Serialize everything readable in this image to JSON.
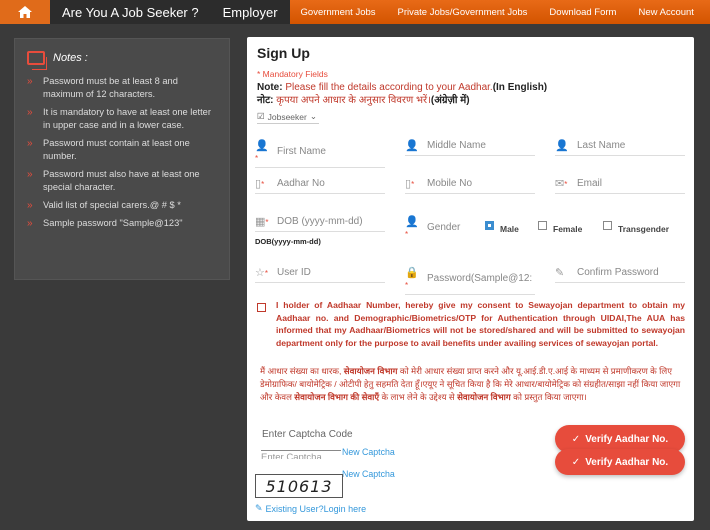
{
  "nav": {
    "home_icon": "home-icon",
    "main": [
      "Are You A Job Seeker ?",
      "Employer"
    ],
    "sub": [
      "Government Jobs",
      "Private Jobs/Government Jobs",
      "Download Form",
      "New Account"
    ]
  },
  "notes": {
    "title": "Notes :",
    "items": [
      "Password must be at least 8 and maximum of 12 characters.",
      "It is mandatory to have at least one letter in upper case and in a lower case.",
      "Password must contain at least one number.",
      "Password must also have at least one special character.",
      "Valid list of special carers.@ # $ *",
      "Sample password \"Sample@123\""
    ]
  },
  "form": {
    "title": "Sign Up",
    "mandatory": "* Mandatory Fields",
    "note_label": "Note:",
    "note_text": " Please fill the details according to your Aadhar.",
    "note_en": "(In English)",
    "note_hi_label": "नोट:",
    "note_hi_text": " कृपया अपने आधार के अनुसार विवरण भरें।",
    "note_hi_bold": "(अंग्रेज़ी में)",
    "user_type": "Jobseeker",
    "fields": {
      "first_name": "First Name",
      "middle_name": "Middle Name",
      "last_name": "Last Name",
      "aadhar": "Aadhar No",
      "mobile": "Mobile No",
      "email": "Email",
      "dob": "DOB (yyyy-mm-dd)",
      "gender": "Gender",
      "user_id": "User ID",
      "password": "Password(Sample@12:",
      "confirm_password": "Confirm Password"
    },
    "gender_options": [
      "Male",
      "Female",
      "Transgender"
    ],
    "gender_selected": "Male",
    "dob_label": "DOB(yyyy-mm-dd)",
    "consent_en": "I holder of Aadhaar Number, hereby give my consent to Sewayojan department to obtain my Aadhaar no. and Demographic/Biometrics/OTP for Authentication through UIDAI,The AUA has informed that my Aadhaar/Biometrics will not be stored/shared and will be submitted to sewayojan department only for the purpose to avail benefits under availing services of sewayojan portal.",
    "consent_hi_1": "मैं आधार संख्या का धारक, ",
    "consent_hi_b1": "सेवायोजन विभाग",
    "consent_hi_2": " को मेरी आधार संख्या प्राप्त करने और यू.आई.डी.ए.आई के माध्यम से प्रमाणीकरण के लिए डेमोग्राफिक/ बायोमेट्रिक / ओटीपी हेतु सहमति देता हूँ।एयूए ने सूचित किया है कि मेरे आधार/बायोमेट्रिक को संग्रहीत/साझा नहीं किया जाएगा और केवल ",
    "consent_hi_b2": "सेवायोजन विभाग की सेवाएँ",
    "consent_hi_3": " के लाभ लेने के उद्देश्य से ",
    "consent_hi_b3": "सेवायोजन विभाग",
    "consent_hi_4": " को प्रस्तुत किया जाएगा।",
    "captcha_placeholder": "Enter Captcha Code",
    "captcha_placeholder2": "Enter Captcha Code",
    "new_captcha": "New Captcha",
    "captcha_value": "510613",
    "verify_button": "Verify Aadhar No.",
    "existing_user": "Existing User?Login here"
  }
}
